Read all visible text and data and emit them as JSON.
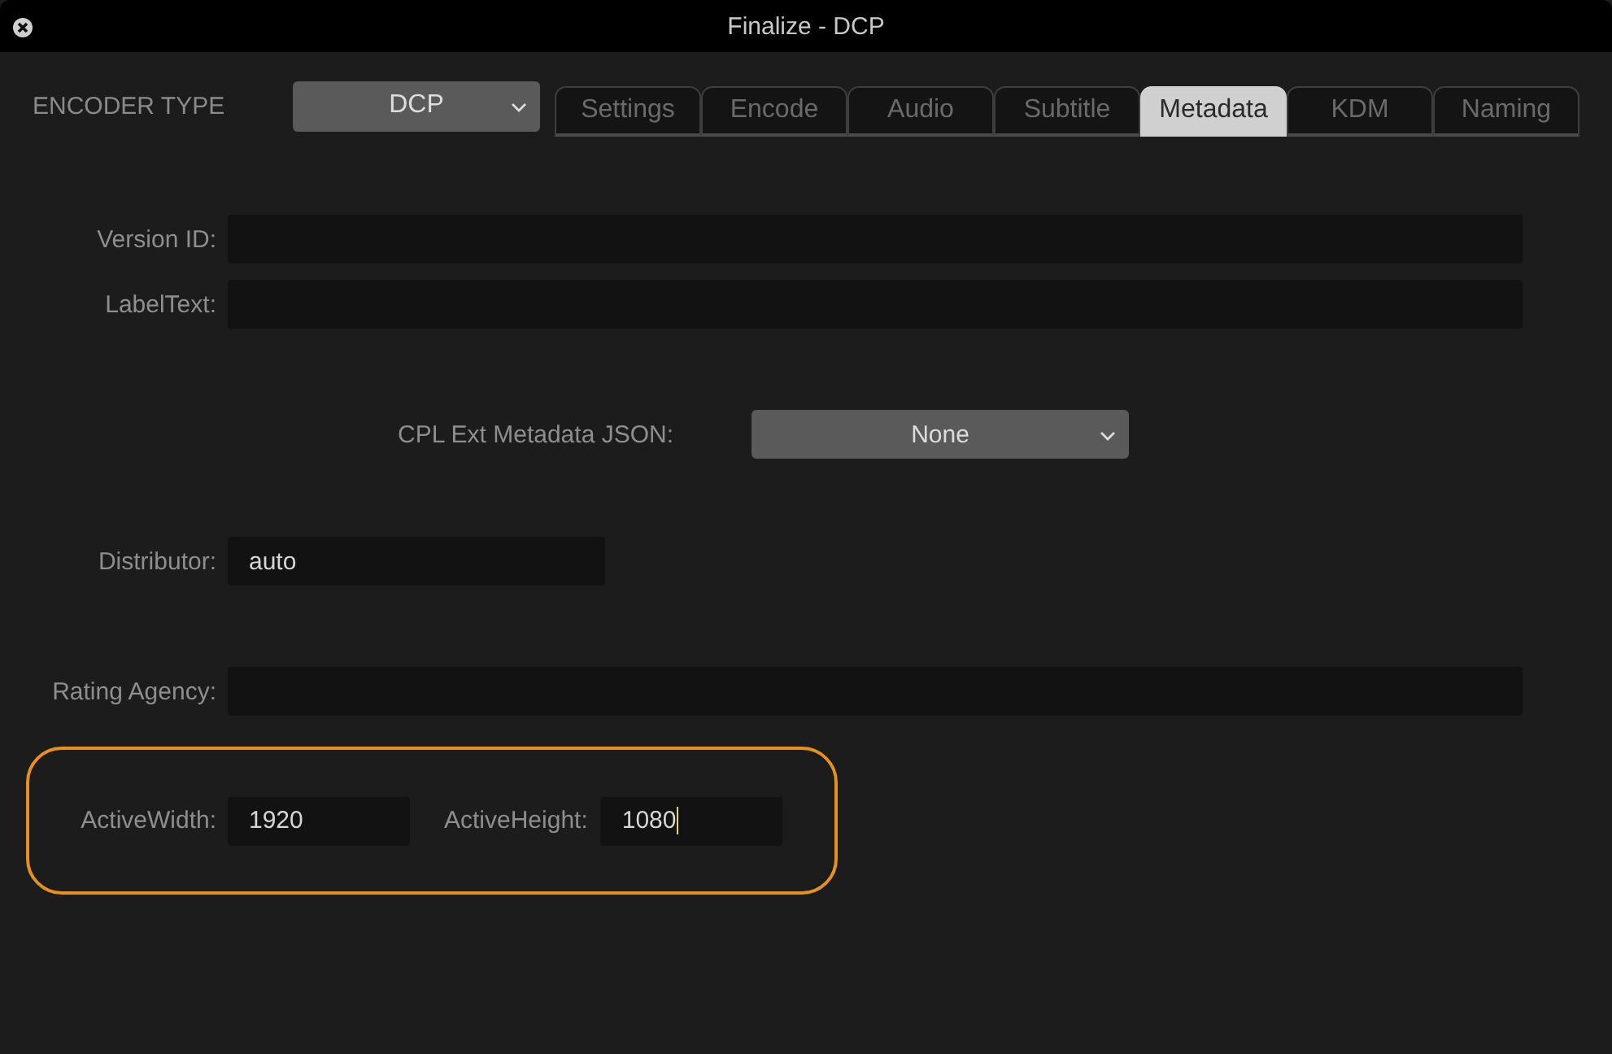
{
  "window": {
    "title": "Finalize - DCP"
  },
  "encoder_type": {
    "label": "ENCODER TYPE",
    "value": "DCP"
  },
  "tabs": [
    {
      "label": "Settings",
      "selected": false
    },
    {
      "label": "Encode",
      "selected": false
    },
    {
      "label": "Audio",
      "selected": false
    },
    {
      "label": "Subtitle",
      "selected": false
    },
    {
      "label": "Metadata",
      "selected": true
    },
    {
      "label": "KDM",
      "selected": false
    },
    {
      "label": "Naming",
      "selected": false
    }
  ],
  "version_id": {
    "label": "Version ID:"
  },
  "label_text": {
    "label": "LabelText:"
  },
  "cpl_ext_metadata": {
    "label": "CPL Ext Metadata JSON:",
    "value": "None"
  },
  "distributor": {
    "label": "Distributor:",
    "value": "auto"
  },
  "rating_agency": {
    "label": "Rating Agency:"
  },
  "active_width": {
    "label": "ActiveWidth:",
    "value": "1920",
    "focused": false
  },
  "active_height": {
    "label": "ActiveHeight:",
    "value": "1080",
    "focused": true
  }
}
